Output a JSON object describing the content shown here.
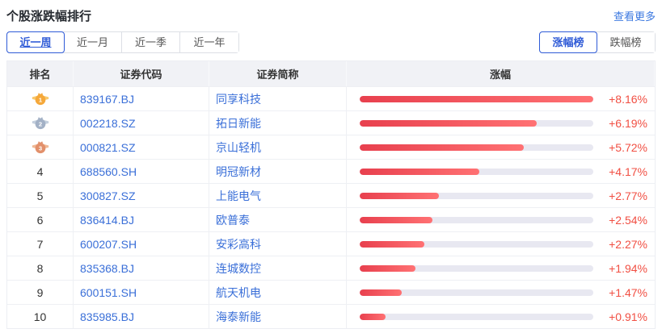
{
  "header": {
    "title": "个股涨跌幅排行",
    "more_link": "查看更多"
  },
  "filters": {
    "period_tabs": [
      {
        "label": "近一周",
        "active": true
      },
      {
        "label": "近一月",
        "active": false
      },
      {
        "label": "近一季",
        "active": false
      },
      {
        "label": "近一年",
        "active": false
      }
    ],
    "board_tabs": [
      {
        "label": "涨幅榜",
        "active": true
      },
      {
        "label": "跌幅榜",
        "active": false
      }
    ]
  },
  "table": {
    "columns": [
      "排名",
      "证券代码",
      "证券简称",
      "涨幅"
    ],
    "max_change_pct": 8.16,
    "rows": [
      {
        "rank": "1",
        "medal": "gold",
        "code": "839167.BJ",
        "name": "同享科技",
        "change": "+8.16%",
        "value": 8.16
      },
      {
        "rank": "2",
        "medal": "silver",
        "code": "002218.SZ",
        "name": "拓日新能",
        "change": "+6.19%",
        "value": 6.19
      },
      {
        "rank": "3",
        "medal": "bronze",
        "code": "000821.SZ",
        "name": "京山轻机",
        "change": "+5.72%",
        "value": 5.72
      },
      {
        "rank": "4",
        "medal": null,
        "code": "688560.SH",
        "name": "明冠新材",
        "change": "+4.17%",
        "value": 4.17
      },
      {
        "rank": "5",
        "medal": null,
        "code": "300827.SZ",
        "name": "上能电气",
        "change": "+2.77%",
        "value": 2.77
      },
      {
        "rank": "6",
        "medal": null,
        "code": "836414.BJ",
        "name": "欧普泰",
        "change": "+2.54%",
        "value": 2.54
      },
      {
        "rank": "7",
        "medal": null,
        "code": "600207.SH",
        "name": "安彩高科",
        "change": "+2.27%",
        "value": 2.27
      },
      {
        "rank": "8",
        "medal": null,
        "code": "835368.BJ",
        "name": "连城数控",
        "change": "+1.94%",
        "value": 1.94
      },
      {
        "rank": "9",
        "medal": null,
        "code": "600151.SH",
        "name": "航天机电",
        "change": "+1.47%",
        "value": 1.47
      },
      {
        "rank": "10",
        "medal": null,
        "code": "835985.BJ",
        "name": "海泰新能",
        "change": "+0.91%",
        "value": 0.91
      }
    ]
  },
  "colors": {
    "accent_blue": "#2F5BD7",
    "link_blue": "#3B78E0",
    "stock_blue": "#3A6FD8",
    "up_red_text": "#F14F43",
    "bar_gradient_start": "#E8404E",
    "bar_gradient_end": "#FF7173",
    "bar_track": "#E8E8F1",
    "header_bg": "#F1F2F6",
    "medals": {
      "gold": {
        "body": "#F5A83A",
        "wing": "#F8C96E"
      },
      "silver": {
        "body": "#A3B1C6",
        "wing": "#C4CFDD"
      },
      "bronze": {
        "body": "#E2906B",
        "wing": "#F0BA97"
      }
    }
  }
}
